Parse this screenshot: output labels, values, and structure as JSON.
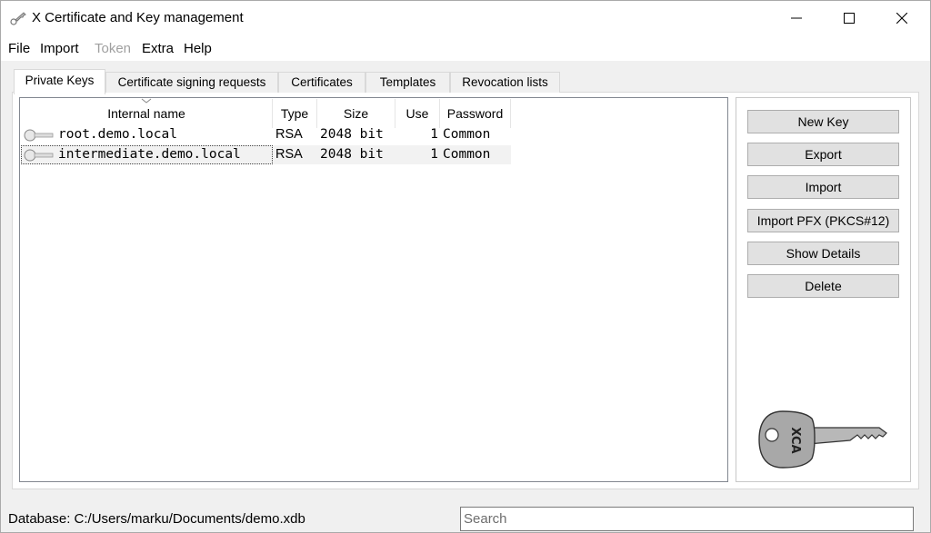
{
  "window": {
    "title": "X Certificate and Key management"
  },
  "menu": {
    "file": "File",
    "import": "Import",
    "token": "Token",
    "extra": "Extra",
    "help": "Help"
  },
  "tabs": [
    {
      "label": "Private Keys"
    },
    {
      "label": "Certificate signing requests"
    },
    {
      "label": "Certificates"
    },
    {
      "label": "Templates"
    },
    {
      "label": "Revocation lists"
    }
  ],
  "table": {
    "columns": [
      "Internal name",
      "Type",
      "Size",
      "Use",
      "Password"
    ],
    "rows": [
      {
        "name": "root.demo.local",
        "type": "RSA",
        "size": "2048 bit",
        "use": "1",
        "password": "Common"
      },
      {
        "name": "intermediate.demo.local",
        "type": "RSA",
        "size": "2048 bit",
        "use": "1",
        "password": "Common"
      }
    ]
  },
  "buttons": {
    "new_key": "New Key",
    "export": "Export",
    "import": "Import",
    "import_pfx": "Import PFX (PKCS#12)",
    "show_details": "Show Details",
    "delete": "Delete"
  },
  "logo": {
    "text": "XCA"
  },
  "status": {
    "database": "Database: C:/Users/marku/Documents/demo.xdb"
  },
  "search": {
    "placeholder": "Search"
  },
  "icons": {
    "app": "key-icon",
    "row": "key-icon",
    "minimize": "minimize-icon",
    "maximize": "maximize-icon",
    "close": "close-icon",
    "sort": "chevron-down-icon"
  },
  "colors": {
    "button_bg": "#e1e1e1",
    "alt_row": "#f2f2f2",
    "disabled_text": "#a0a0a0"
  }
}
